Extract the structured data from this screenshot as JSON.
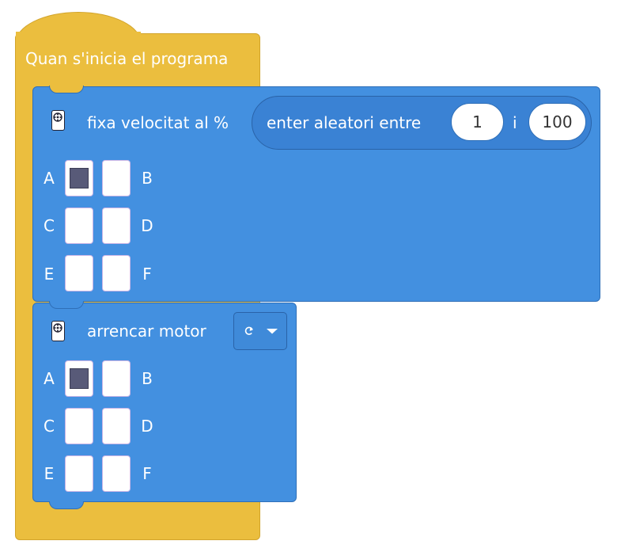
{
  "hat": {
    "label": "Quan s'inicia el programa"
  },
  "speed_block": {
    "label": "fixa velocitat al %",
    "random": {
      "label": "enter aleatori entre",
      "min": "1",
      "sep": "i",
      "max": "100"
    },
    "ports": [
      {
        "left": "A",
        "right": "B",
        "left_selected": true,
        "right_selected": false
      },
      {
        "left": "C",
        "right": "D",
        "left_selected": false,
        "right_selected": false
      },
      {
        "left": "E",
        "right": "F",
        "left_selected": false,
        "right_selected": false
      }
    ]
  },
  "start_block": {
    "label": "arrencar motor",
    "direction_icon": "clockwise-icon",
    "ports": [
      {
        "left": "A",
        "right": "B",
        "left_selected": true,
        "right_selected": false
      },
      {
        "left": "C",
        "right": "D",
        "left_selected": false,
        "right_selected": false
      },
      {
        "left": "E",
        "right": "F",
        "left_selected": false,
        "right_selected": false
      }
    ]
  },
  "colors": {
    "hat": "#ebbe3e",
    "block": "#4390e0",
    "selected_port": "#585a78"
  }
}
